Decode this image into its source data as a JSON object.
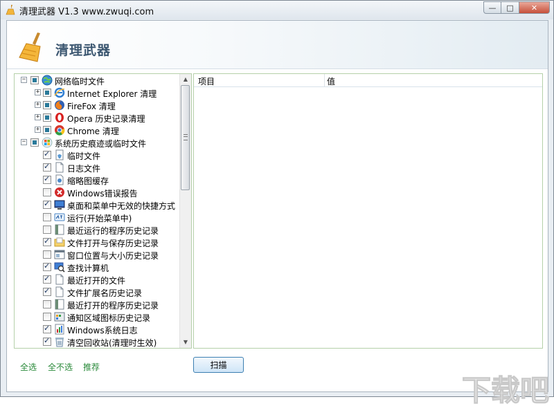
{
  "window": {
    "title": "清理武器 V1.3 www.zwuqi.com",
    "controls": {
      "minimize": "—",
      "maximize": "□",
      "close": "✕"
    }
  },
  "banner": {
    "title": "清理武器",
    "icon": "broom-icon"
  },
  "tree": [
    {
      "label": "网络临时文件",
      "level": 0,
      "expander": "−",
      "check": "partial",
      "icon": "globe-icon"
    },
    {
      "label": "Internet Explorer 清理",
      "level": 1,
      "expander": "+",
      "check": "partial",
      "icon": "ie-icon"
    },
    {
      "label": "FireFox 清理",
      "level": 1,
      "expander": "+",
      "check": "partial",
      "icon": "firefox-icon"
    },
    {
      "label": "Opera 历史记录清理",
      "level": 1,
      "expander": "+",
      "check": "partial",
      "icon": "opera-icon"
    },
    {
      "label": "Chrome 清理",
      "level": 1,
      "expander": "+",
      "check": "partial",
      "icon": "chrome-icon"
    },
    {
      "label": "系统历史痕迹或临时文件",
      "level": 0,
      "expander": "−",
      "check": "partial",
      "icon": "windows-icon"
    },
    {
      "label": "临时文件",
      "level": 2,
      "check": "checked",
      "icon": "temp-file-icon"
    },
    {
      "label": "日志文件",
      "level": 2,
      "check": "checked",
      "icon": "document-icon"
    },
    {
      "label": "缩略图缓存",
      "level": 2,
      "check": "checked",
      "icon": "thumbnail-icon"
    },
    {
      "label": "Windows错误报告",
      "level": 2,
      "check": "unchecked",
      "icon": "error-icon"
    },
    {
      "label": "桌面和菜单中无效的快捷方式",
      "level": 2,
      "check": "checked",
      "icon": "monitor-icon"
    },
    {
      "label": "运行(开始菜单中)",
      "level": 2,
      "check": "unchecked",
      "icon": "run-icon"
    },
    {
      "label": "最近运行的程序历史记录",
      "level": 2,
      "check": "unchecked",
      "icon": "program-list-icon"
    },
    {
      "label": "文件打开与保存历史记录",
      "level": 2,
      "check": "checked",
      "icon": "folder-icon"
    },
    {
      "label": "窗口位置与大小历史记录",
      "level": 2,
      "check": "unchecked",
      "icon": "window-icon"
    },
    {
      "label": "查找计算机",
      "level": 2,
      "check": "checked",
      "icon": "search-computer-icon"
    },
    {
      "label": "最近打开的文件",
      "level": 2,
      "check": "checked",
      "icon": "document-icon"
    },
    {
      "label": "文件扩展名历史记录",
      "level": 2,
      "check": "checked",
      "icon": "document-icon"
    },
    {
      "label": "最近打开的程序历史记录",
      "level": 2,
      "check": "unchecked",
      "icon": "program-list-icon"
    },
    {
      "label": "通知区域图标历史记录",
      "level": 2,
      "check": "unchecked",
      "icon": "tray-icon"
    },
    {
      "label": "Windows系统日志",
      "level": 2,
      "check": "checked",
      "icon": "system-log-icon"
    },
    {
      "label": "清空回收站(清理时生效)",
      "level": 2,
      "check": "checked",
      "icon": "recycle-bin-icon"
    }
  ],
  "list": {
    "columns": [
      "项目",
      "值"
    ]
  },
  "actions": {
    "select_all": "全选",
    "select_none": "全不选",
    "recommend": "推荐",
    "scan": "扫描"
  },
  "watermark": "下载吧",
  "colors": {
    "link": "#2a8a3a",
    "panel_border": "#b5d0a9",
    "banner_title": "#3b5670",
    "accent_blue": "#3c7fb1"
  }
}
